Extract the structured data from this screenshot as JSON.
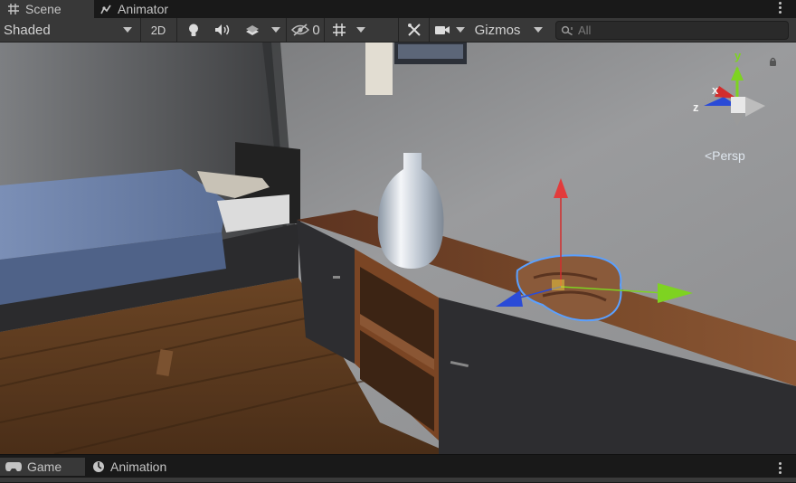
{
  "tabs": {
    "scene": "Scene",
    "animator": "Animator",
    "game": "Game",
    "animation": "Animation"
  },
  "toolbar": {
    "shading_mode": "Shaded",
    "two_d": "2D",
    "hidden_count": "0",
    "gizmos": "Gizmos",
    "search_placeholder": "All"
  },
  "gizmo": {
    "axis_x": "x",
    "axis_y": "y",
    "axis_z": "z",
    "projection": "<Persp"
  },
  "colors": {
    "panel": "#383838",
    "tab_bg": "#191919",
    "axis_x": "#d22d2d",
    "axis_y": "#7ed321",
    "axis_z": "#2a4bd7",
    "selection_outline": "#5aa0ff"
  },
  "icons": [
    "grid-icon",
    "animator-icon",
    "lightbulb-icon",
    "audio-icon",
    "effects-icon",
    "hidden-eye-icon",
    "grid-snap-icon",
    "tools-icon",
    "camera-icon",
    "search-icon",
    "lock-icon",
    "game-icon",
    "animation-icon",
    "kebab-icon"
  ]
}
